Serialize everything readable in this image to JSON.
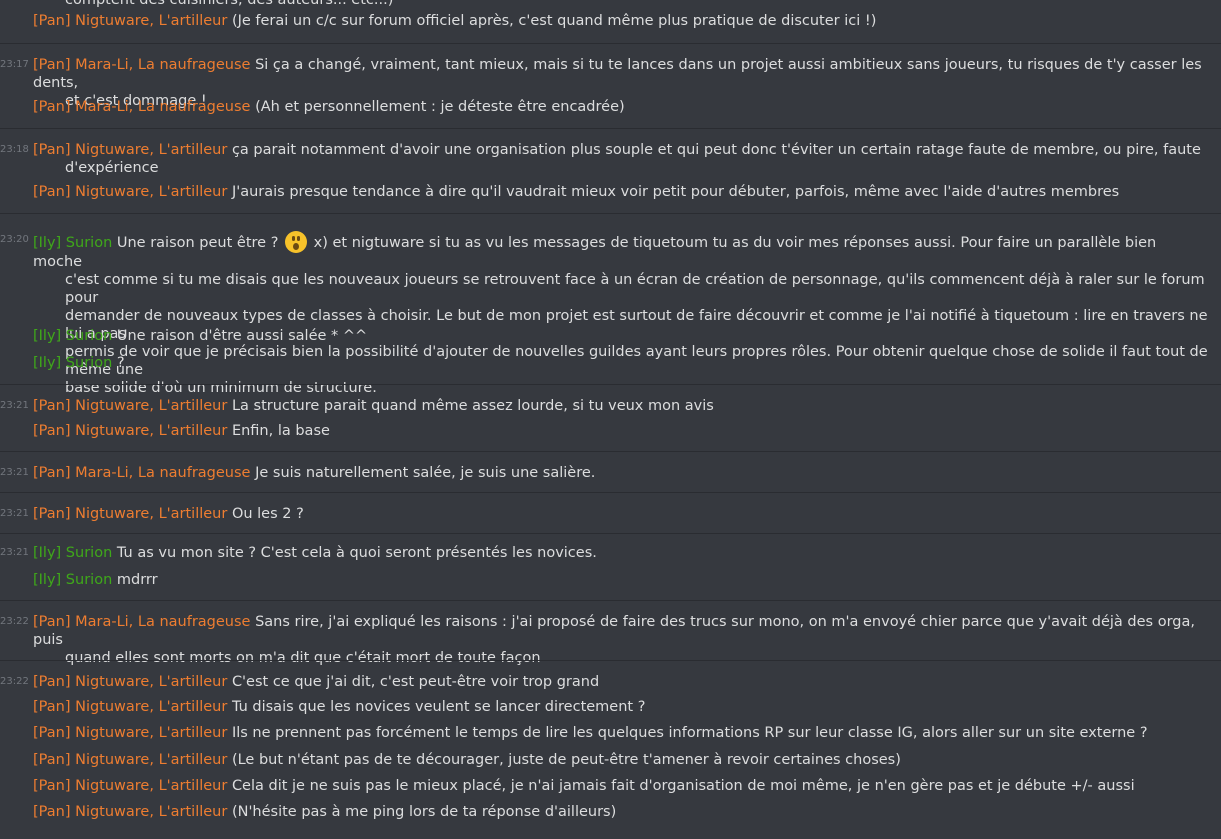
{
  "groups": [
    {
      "time": "",
      "messages": [
        {
          "author": "[Pan] Nigtuware, L'artilleur",
          "team": "pan",
          "text": "(Je ferai un c/c sur forum officiel après, c'est quand même plus pratique de discuter ici !)"
        }
      ]
    },
    {
      "time": "23:17",
      "messages": [
        {
          "author": "[Pan] Mara-Li, La naufrageuse",
          "team": "pan",
          "text": "Si ça a changé, vraiment, tant mieux, mais si tu te lances dans un projet aussi ambitieux sans joueurs, tu risques de t'y casser les dents,",
          "cont": "et c'est dommage !"
        },
        {
          "author": "[Pan] Mara-Li, La naufrageuse",
          "team": "pan",
          "text": "(Ah et personnellement : je déteste être encadrée)"
        }
      ]
    },
    {
      "time": "23:18",
      "messages": [
        {
          "author": "[Pan] Nigtuware, L'artilleur",
          "team": "pan",
          "text": "ça parait notamment d'avoir une organisation plus souple et qui peut donc t'éviter un certain ratage faute de membre, ou pire, faute",
          "cont": "d'expérience"
        },
        {
          "author": "[Pan] Nigtuware, L'artilleur",
          "team": "pan",
          "text": "J'aurais presque tendance à dire qu'il vaudrait mieux voir petit pour débuter, parfois, même avec l'aide d'autres membres"
        }
      ]
    },
    {
      "time": "23:20",
      "messages": [
        {
          "author": "[Ily] Surion",
          "team": "ily",
          "text": "Une raison peut être ?",
          "emoji": "hushed-face-emoji",
          "after": "x) et nigtuware si tu as vu les messages de tiquetoum tu as du voir mes réponses aussi. Pour faire un parallèle bien moche",
          "cont": "c'est comme si tu me disais que les nouveaux joueurs se retrouvent face à un écran de création de personnage, qu'ils commencent déjà à raler sur le forum pour",
          "cont2": "demander de nouveaux types de classes à choisir. Le but de mon projet est surtout de faire découvrir et comme je l'ai notifié à tiquetoum : lire en travers ne lui a pas",
          "cont3": "permis de voir que je précisais bien la possibilité d'ajouter de nouvelles guildes ayant leurs propres rôles. Pour obtenir quelque chose de solide il faut tout de même une",
          "cont4": "base solide d'où un minimum de structure."
        },
        {
          "author": "[Ily] Surion",
          "team": "ily",
          "text": "Une raison d'être aussi salée * ^^"
        },
        {
          "author": "[Ily] Surion",
          "team": "ily",
          "text": "?"
        }
      ]
    },
    {
      "time": "23:21",
      "messages": [
        {
          "author": "[Pan] Nigtuware, L'artilleur",
          "team": "pan",
          "text": "La structure parait quand même assez lourde, si tu veux mon avis"
        },
        {
          "author": "[Pan] Nigtuware, L'artilleur",
          "team": "pan",
          "text": "Enfin, la base"
        }
      ]
    },
    {
      "time": "23:21",
      "messages": [
        {
          "author": "[Pan] Mara-Li, La naufrageuse",
          "team": "pan",
          "text": "Je suis naturellement salée, je suis une salière."
        }
      ]
    },
    {
      "time": "23:21",
      "messages": [
        {
          "author": "[Pan] Nigtuware, L'artilleur",
          "team": "pan",
          "text": "Ou les 2 ?"
        }
      ]
    },
    {
      "time": "23:21",
      "messages": [
        {
          "author": "[Ily] Surion",
          "team": "ily",
          "text": "Tu as vu mon site ? C'est cela à quoi seront présentés les novices."
        },
        {
          "author": "[Ily] Surion",
          "team": "ily",
          "text": "mdrrr"
        }
      ]
    },
    {
      "time": "23:22",
      "messages": [
        {
          "author": "[Pan] Mara-Li, La naufrageuse",
          "team": "pan",
          "text": "Sans rire, j'ai expliqué les raisons : j'ai proposé de faire des trucs sur mono, on m'a envoyé chier parce que y'avait déjà des orga, puis",
          "cont": "quand elles sont morts on m'a dit que c'était mort de toute façon"
        }
      ]
    },
    {
      "time": "23:22",
      "messages": [
        {
          "author": "[Pan] Nigtuware, L'artilleur",
          "team": "pan",
          "text": "C'est ce que j'ai dit, c'est peut-être voir trop grand"
        },
        {
          "author": "[Pan] Nigtuware, L'artilleur",
          "team": "pan",
          "text": "Tu disais que les novices veulent se lancer directement ?"
        },
        {
          "author": "[Pan] Nigtuware, L'artilleur",
          "team": "pan",
          "text": "Ils ne prennent pas forcément le temps de lire les quelques informations RP sur leur classe IG, alors aller sur un site externe ?"
        },
        {
          "author": "[Pan] Nigtuware, L'artilleur",
          "team": "pan",
          "text": "(Le but n'étant pas de te décourager, juste de peut-être t'amener à revoir certaines choses)"
        },
        {
          "author": "[Pan] Nigtuware, L'artilleur",
          "team": "pan",
          "text": "Cela dit je ne suis pas le mieux placé, je n'ai jamais fait d'organisation de moi même, je n'en gère pas et je débute +/- aussi"
        },
        {
          "author": "[Pan] Nigtuware, L'artilleur",
          "team": "pan",
          "text": "(N'hésite pas à me ping lors de ta réponse d'ailleurs)"
        }
      ]
    }
  ],
  "partial_top_line": "comptent des cuisiniers, des auteurs... etc...)"
}
